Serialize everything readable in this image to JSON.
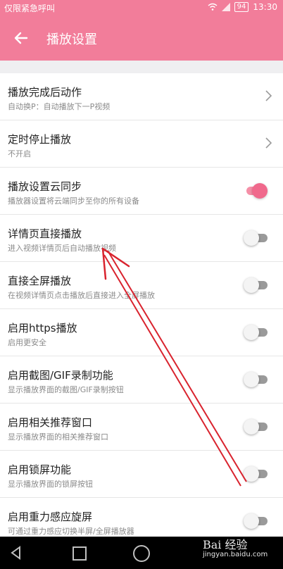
{
  "status": {
    "carrier": "仅限紧急呼叫",
    "battery": "94",
    "time": "13:30"
  },
  "header": {
    "title": "播放设置"
  },
  "settings": [
    {
      "title": "播放完成后动作",
      "subtitle": "自动换P：自动播放下一P视频",
      "control": "chevron"
    },
    {
      "title": "定时停止播放",
      "subtitle": "不开启",
      "control": "chevron"
    },
    {
      "title": "播放设置云同步",
      "subtitle": "播放器设置将云端同步至你的所有设备",
      "control": "toggle",
      "on": true
    },
    {
      "title": "详情页直接播放",
      "subtitle": "进入视频详情页后自动播放视频",
      "control": "toggle",
      "on": false
    },
    {
      "title": "直接全屏播放",
      "subtitle": "在视频详情页点击播放后直接进入全屏播放",
      "control": "toggle",
      "on": false
    },
    {
      "title": "启用https播放",
      "subtitle": "启用更安全",
      "control": "toggle",
      "on": false
    },
    {
      "title": "启用截图/GIF录制功能",
      "subtitle": "显示播放界面的截图/GIF录制按钮",
      "control": "toggle",
      "on": false
    },
    {
      "title": "启用相关推荐窗口",
      "subtitle": "显示播放界面的相关推荐窗口",
      "control": "toggle",
      "on": false
    },
    {
      "title": "启用锁屏功能",
      "subtitle": "显示播放界面的锁屏按钮",
      "control": "toggle",
      "on": false
    },
    {
      "title": "启用重力感应旋屏",
      "subtitle": "可通过重力感应切换半屏/全屏播放器",
      "control": "toggle",
      "on": false
    }
  ],
  "watermark": {
    "brand": "Bai 经验",
    "url": "jingyan.baidu.com"
  },
  "colors": {
    "accent": "#f27d9a",
    "toggle_on": "#f0698c",
    "annotation_arrow": "#d9232e"
  }
}
